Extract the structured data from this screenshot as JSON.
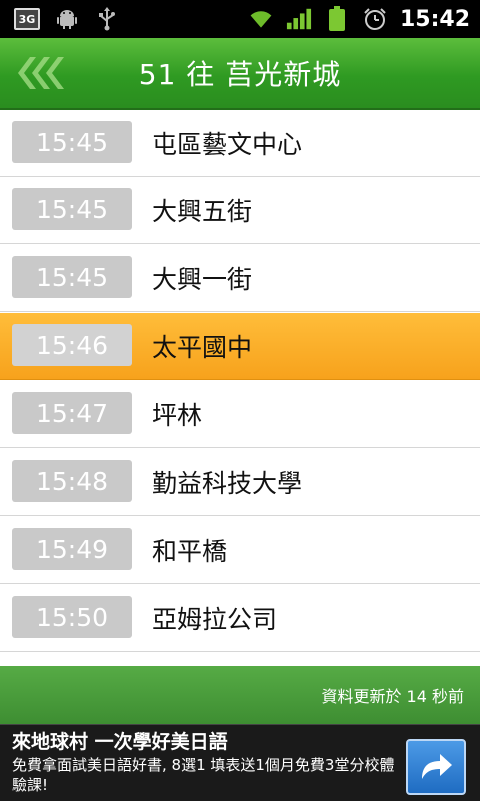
{
  "status_bar": {
    "time": "15:42",
    "network_label": "3G",
    "icons": [
      "3g-icon",
      "android-icon",
      "usb-icon",
      "wifi-icon",
      "signal-icon",
      "battery-icon",
      "alarm-icon"
    ]
  },
  "header": {
    "title": "51  往 莒光新城",
    "back_icon": "back-chevrons-icon"
  },
  "stops": [
    {
      "time": "15:45",
      "name": "屯區藝文中心",
      "active": false
    },
    {
      "time": "15:45",
      "name": "大興五街",
      "active": false
    },
    {
      "time": "15:45",
      "name": "大興一街",
      "active": false
    },
    {
      "time": "15:46",
      "name": "太平國中",
      "active": true
    },
    {
      "time": "15:47",
      "name": "坪林",
      "active": false
    },
    {
      "time": "15:48",
      "name": "勤益科技大學",
      "active": false
    },
    {
      "time": "15:49",
      "name": "和平橋",
      "active": false
    },
    {
      "time": "15:50",
      "name": "亞姆拉公司",
      "active": false
    }
  ],
  "footer": {
    "updated_text": "資料更新於 14 秒前"
  },
  "ad": {
    "title": "來地球村 一次學好美日語",
    "description": "免費拿面試美日語好書, 8選1 填表送1個月免費3堂分校體驗課!",
    "action_icon": "share-arrow-icon"
  },
  "colors": {
    "header_green": "#2f9a22",
    "active_row": "#f7a21c",
    "time_box": "#c9c9c9",
    "footer_green": "#3e8e32"
  }
}
